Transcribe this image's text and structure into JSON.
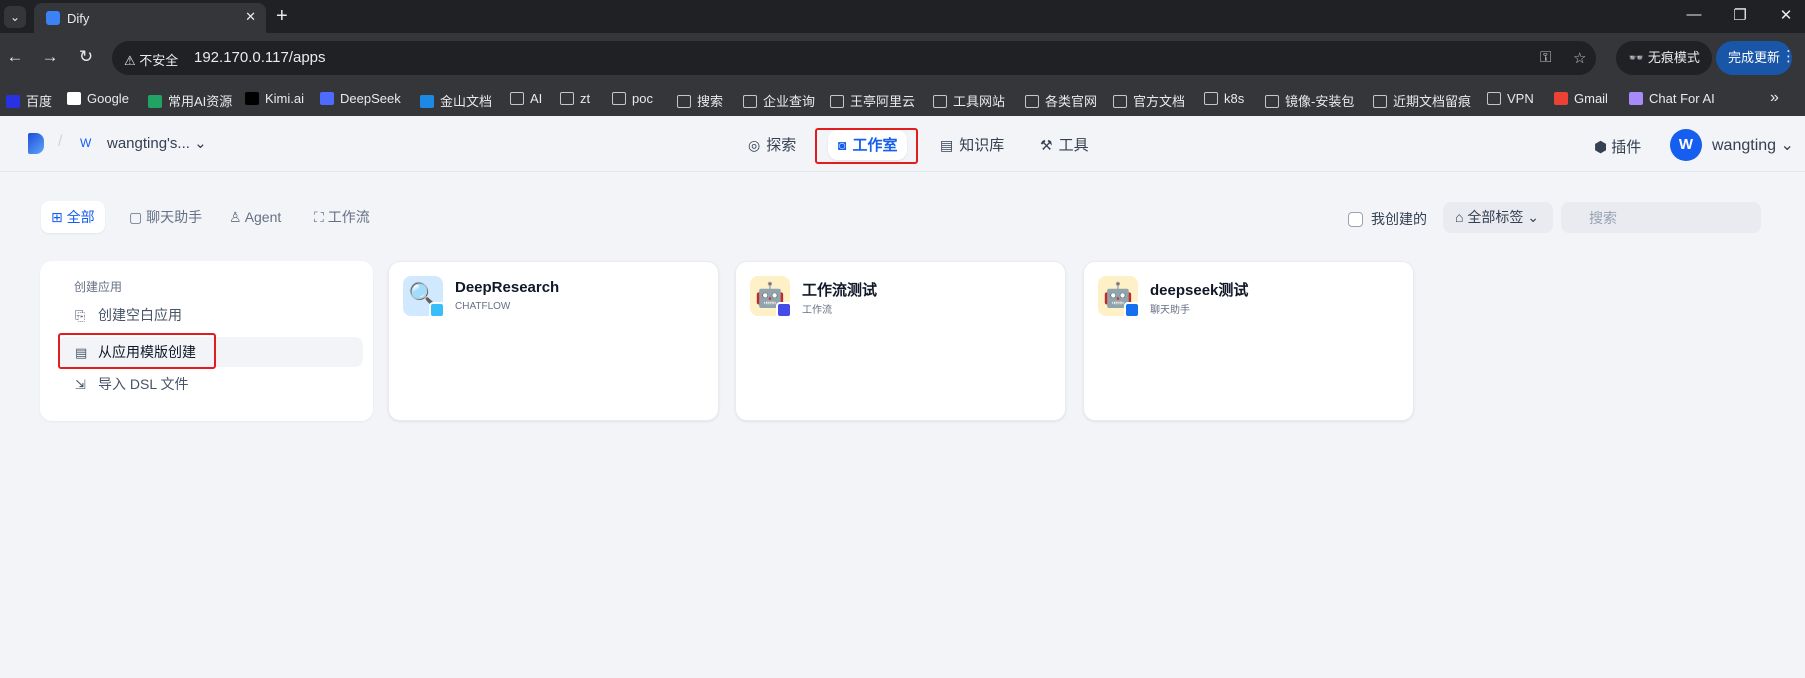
{
  "browser": {
    "tab_title": "Dify",
    "url": "192.170.0.117/apps",
    "insecure_label": "不安全",
    "incognito_label": "无痕模式",
    "update_label": "完成更新"
  },
  "bookmarks": [
    {
      "label": "百度",
      "icon": "baidu-icon"
    },
    {
      "label": "Google",
      "icon": "google-icon"
    },
    {
      "label": "常用AI资源",
      "icon": "sheet-icon"
    },
    {
      "label": "Kimi.ai",
      "icon": "kimi-icon"
    },
    {
      "label": "DeepSeek",
      "icon": "deepseek-icon"
    },
    {
      "label": "金山文档",
      "icon": "wps-icon"
    },
    {
      "label": "AI",
      "icon": "folder-icon"
    },
    {
      "label": "zt",
      "icon": "folder-icon"
    },
    {
      "label": "poc",
      "icon": "folder-icon"
    },
    {
      "label": "搜索",
      "icon": "folder-icon"
    },
    {
      "label": "企业查询",
      "icon": "folder-icon"
    },
    {
      "label": "王亭阿里云",
      "icon": "folder-icon"
    },
    {
      "label": "工具网站",
      "icon": "folder-icon"
    },
    {
      "label": "各类官网",
      "icon": "folder-icon"
    },
    {
      "label": "官方文档",
      "icon": "folder-icon"
    },
    {
      "label": "k8s",
      "icon": "folder-icon"
    },
    {
      "label": "镜像-安装包",
      "icon": "folder-icon"
    },
    {
      "label": "近期文档留痕",
      "icon": "folder-icon"
    },
    {
      "label": "VPN",
      "icon": "folder-icon"
    },
    {
      "label": "Gmail",
      "icon": "gmail-icon"
    },
    {
      "label": "Chat For AI",
      "icon": "chat-icon"
    }
  ],
  "header": {
    "workspace_initial": "W",
    "workspace_name": "wangting's...",
    "nav": [
      {
        "label": "探索",
        "icon": "compass-icon"
      },
      {
        "label": "工作室",
        "icon": "robot-icon"
      },
      {
        "label": "知识库",
        "icon": "book-icon"
      },
      {
        "label": "工具",
        "icon": "hammer-icon"
      }
    ],
    "plugins_label": "插件",
    "avatar_initial": "W",
    "username": "wangting"
  },
  "filters": {
    "tabs": [
      "全部",
      "聊天助手",
      "Agent",
      "工作流"
    ],
    "created_by_me": "我创建的",
    "all_tags": "全部标签",
    "search_placeholder": "搜索"
  },
  "create": {
    "title": "创建应用",
    "items": [
      "创建空白应用",
      "从应用模版创建",
      "导入 DSL 文件"
    ]
  },
  "apps": [
    {
      "name": "DeepResearch",
      "type": "CHATFLOW",
      "icon": "magnifier-icon",
      "icon_bg": "#d1e9ff",
      "badge_color": "#36bffa"
    },
    {
      "name": "工作流测试",
      "type": "工作流",
      "icon": "robot-face-icon",
      "icon_bg": "#fef0c7",
      "badge_color": "#444ce7"
    },
    {
      "name": "deepseek测试",
      "type": "聊天助手",
      "icon": "robot-face-icon",
      "icon_bg": "#fef0c7",
      "badge_color": "#1570ef"
    }
  ]
}
